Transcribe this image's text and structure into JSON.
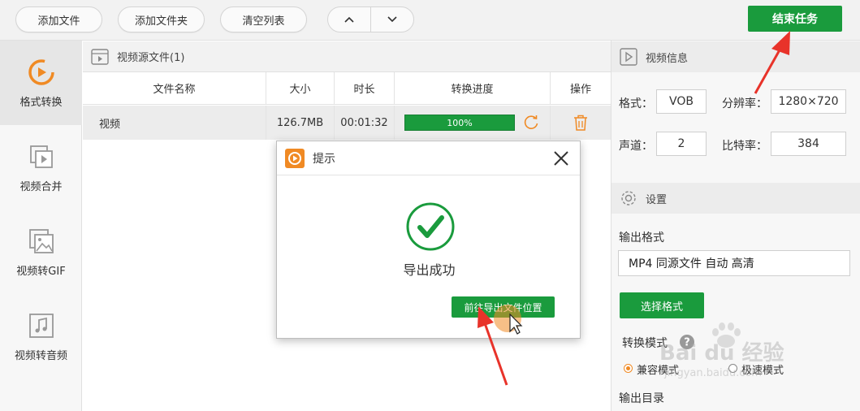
{
  "toolbar": {
    "add_file": "添加文件",
    "add_folder": "添加文件夹",
    "clear_list": "清空列表",
    "end_task": "结束任务"
  },
  "sidebar": {
    "items": [
      {
        "label": "格式转换",
        "icon": "format-convert-icon"
      },
      {
        "label": "视频合并",
        "icon": "video-merge-icon"
      },
      {
        "label": "视频转GIF",
        "icon": "image-icon"
      },
      {
        "label": "视频转音频",
        "icon": "music-note-icon"
      }
    ]
  },
  "file_panel": {
    "title": "视频源文件(1)",
    "columns": [
      "文件名称",
      "大小",
      "时长",
      "转换进度",
      "操作"
    ],
    "rows": [
      {
        "name": "视频",
        "size": "126.7MB",
        "duration": "00:01:32",
        "progress_label": "100%",
        "progress": 1.0
      }
    ]
  },
  "video_info": {
    "title": "视频信息",
    "format_label": "格式：",
    "format_value": "VOB",
    "resolution_label": "分辨率：",
    "resolution_value": "1280×720",
    "channel_label": "声道：",
    "channel_value": "2",
    "bitrate_label": "比特率：",
    "bitrate_value": "384"
  },
  "settings": {
    "title": "设置",
    "output_format_label": "输出格式",
    "output_format_value": "MP4 同源文件 自动 高清",
    "select_format_button": "选择格式",
    "convert_mode_label": "转换模式",
    "mode_compatible": "兼容模式",
    "mode_fast": "极速模式",
    "output_dir_label": "输出目录"
  },
  "dialog": {
    "title": "提示",
    "message": "导出成功",
    "button": "前往导出文件位置"
  },
  "watermark": {
    "brand": "Bai du 经验",
    "url": "jingyan.baidu.com"
  },
  "colors": {
    "accent_green": "#1a9b3d",
    "accent_orange": "#f08a24",
    "annotation_red": "#e8332a"
  }
}
